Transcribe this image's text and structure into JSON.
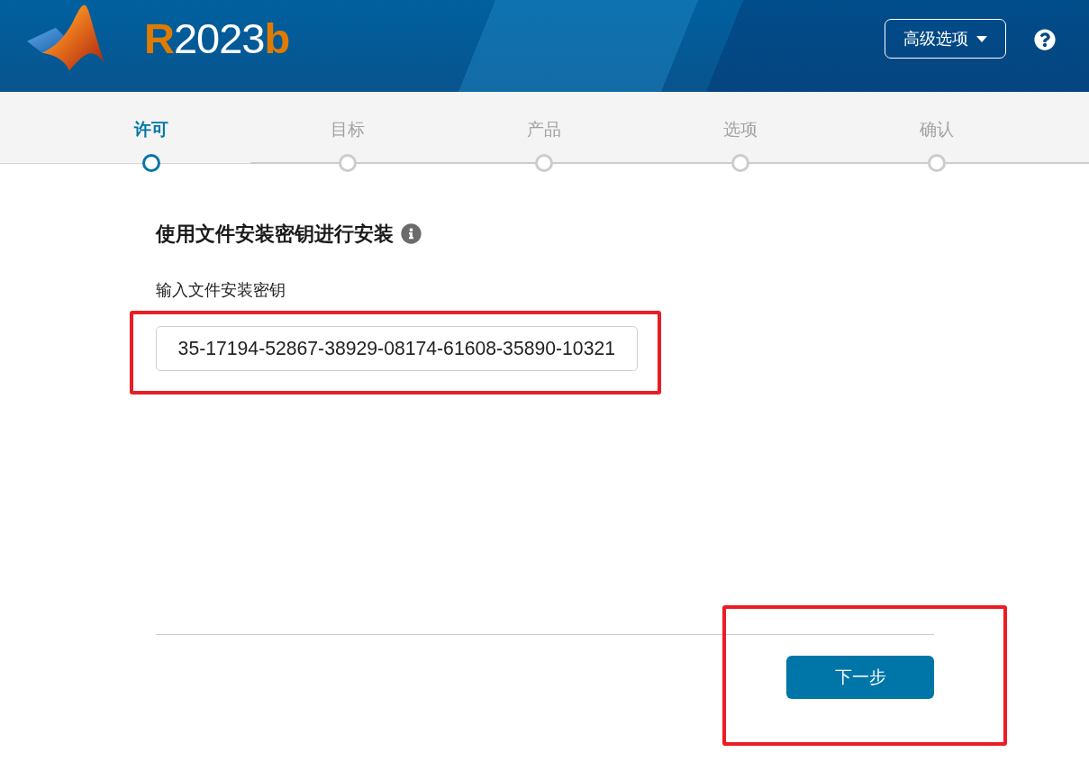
{
  "header": {
    "logo_text": "**R**2023**b**",
    "advanced_button": {
      "label": "高级选项"
    }
  },
  "steps": [
    {
      "label": "许可",
      "selected": true
    },
    {
      "label": "目标",
      "selected": false
    },
    {
      "label": "产品",
      "selected": false
    },
    {
      "label": "选项",
      "selected": false
    },
    {
      "label": "确认",
      "selected": false
    }
  ],
  "section": {
    "title": "使用文件安装密钥进行安装",
    "field": {
      "label": "输入文件安装密钥",
      "value": "35-17194-52867-38929-08174-61608-35890-10321",
      "highlighted": true
    }
  },
  "footer": {
    "next_button": {
      "label": "下一步",
      "highlighted": true
    }
  }
}
